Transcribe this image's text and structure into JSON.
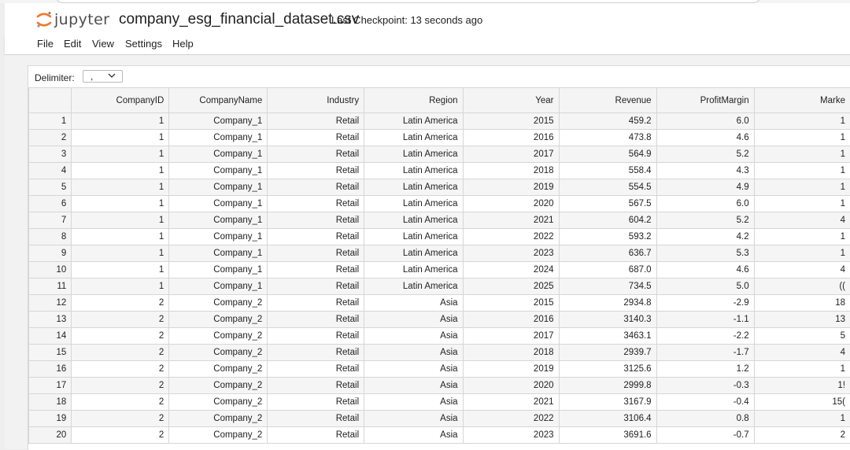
{
  "app": {
    "logo_text": "jupyter",
    "document_title": "company_esg_financial_dataset.csv",
    "checkpoint": "Last Checkpoint: 13 seconds ago",
    "logo_color": "#f37726"
  },
  "menu": {
    "items": [
      {
        "label": "File"
      },
      {
        "label": "Edit"
      },
      {
        "label": "View"
      },
      {
        "label": "Settings"
      },
      {
        "label": "Help"
      }
    ]
  },
  "toolbar": {
    "delimiter_label": "Delimiter:",
    "delimiter_value": ","
  },
  "grid": {
    "columns": [
      "",
      "CompanyID",
      "CompanyName",
      "Industry",
      "Region",
      "Year",
      "Revenue",
      "ProfitMargin",
      "Marke"
    ],
    "rows": [
      [
        "1",
        "1",
        "Company_1",
        "Retail",
        "Latin America",
        "2015",
        "459.2",
        "6.0",
        "1"
      ],
      [
        "2",
        "1",
        "Company_1",
        "Retail",
        "Latin America",
        "2016",
        "473.8",
        "4.6",
        "1"
      ],
      [
        "3",
        "1",
        "Company_1",
        "Retail",
        "Latin America",
        "2017",
        "564.9",
        "5.2",
        "1"
      ],
      [
        "4",
        "1",
        "Company_1",
        "Retail",
        "Latin America",
        "2018",
        "558.4",
        "4.3",
        "1"
      ],
      [
        "5",
        "1",
        "Company_1",
        "Retail",
        "Latin America",
        "2019",
        "554.5",
        "4.9",
        "1"
      ],
      [
        "6",
        "1",
        "Company_1",
        "Retail",
        "Latin America",
        "2020",
        "567.5",
        "6.0",
        "1"
      ],
      [
        "7",
        "1",
        "Company_1",
        "Retail",
        "Latin America",
        "2021",
        "604.2",
        "5.2",
        "4"
      ],
      [
        "8",
        "1",
        "Company_1",
        "Retail",
        "Latin America",
        "2022",
        "593.2",
        "4.2",
        "1"
      ],
      [
        "9",
        "1",
        "Company_1",
        "Retail",
        "Latin America",
        "2023",
        "636.7",
        "5.3",
        "1"
      ],
      [
        "10",
        "1",
        "Company_1",
        "Retail",
        "Latin America",
        "2024",
        "687.0",
        "4.6",
        "4"
      ],
      [
        "11",
        "1",
        "Company_1",
        "Retail",
        "Latin America",
        "2025",
        "734.5",
        "5.0",
        "(("
      ],
      [
        "12",
        "2",
        "Company_2",
        "Retail",
        "Asia",
        "2015",
        "2934.8",
        "-2.9",
        "18"
      ],
      [
        "13",
        "2",
        "Company_2",
        "Retail",
        "Asia",
        "2016",
        "3140.3",
        "-1.1",
        "13"
      ],
      [
        "14",
        "2",
        "Company_2",
        "Retail",
        "Asia",
        "2017",
        "3463.1",
        "-2.2",
        "5"
      ],
      [
        "15",
        "2",
        "Company_2",
        "Retail",
        "Asia",
        "2018",
        "2939.7",
        "-1.7",
        "4"
      ],
      [
        "16",
        "2",
        "Company_2",
        "Retail",
        "Asia",
        "2019",
        "3125.6",
        "1.2",
        "1"
      ],
      [
        "17",
        "2",
        "Company_2",
        "Retail",
        "Asia",
        "2020",
        "2999.8",
        "-0.3",
        "1!"
      ],
      [
        "18",
        "2",
        "Company_2",
        "Retail",
        "Asia",
        "2021",
        "3167.9",
        "-0.4",
        "15("
      ],
      [
        "19",
        "2",
        "Company_2",
        "Retail",
        "Asia",
        "2022",
        "3106.4",
        "0.8",
        "1"
      ],
      [
        "20",
        "2",
        "Company_2",
        "Retail",
        "Asia",
        "2023",
        "3691.6",
        "-0.7",
        "2"
      ]
    ]
  }
}
